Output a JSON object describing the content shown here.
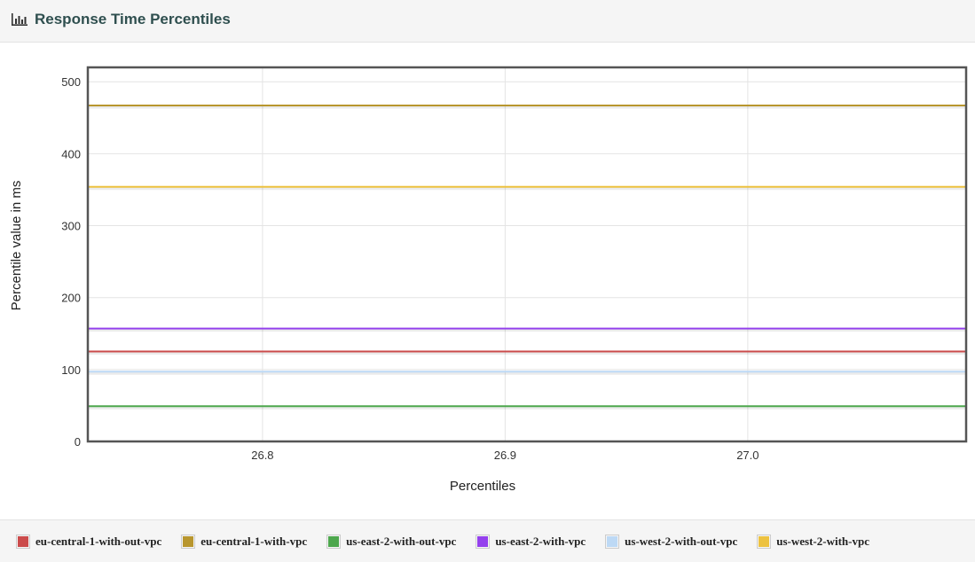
{
  "header": {
    "title": "Response Time Percentiles",
    "icon": "bar-chart-icon"
  },
  "chart_data": {
    "type": "line",
    "xlabel": "Percentiles",
    "ylabel": "Percentile value in ms",
    "xlim": [
      26.728,
      27.09
    ],
    "ylim": [
      0,
      520
    ],
    "xticks": [
      "26.8",
      "26.9",
      "27.0",
      "27.1",
      "27.2"
    ],
    "yticks": [
      "0",
      "100",
      "200",
      "300",
      "400",
      "500"
    ],
    "grid": true,
    "legend_position": "bottom",
    "series": [
      {
        "name": "eu-central-1-with-out-vpc",
        "color": "#cb4b4b",
        "x": [
          26.728,
          27.09
        ],
        "y": [
          125,
          125
        ]
      },
      {
        "name": "eu-central-1-with-vpc",
        "color": "#b8962e",
        "x": [
          26.728,
          27.09
        ],
        "y": [
          467,
          467
        ]
      },
      {
        "name": "us-east-2-with-out-vpc",
        "color": "#4da74d",
        "x": [
          26.728,
          27.09
        ],
        "y": [
          49,
          49
        ]
      },
      {
        "name": "us-east-2-with-vpc",
        "color": "#9440ed",
        "x": [
          26.728,
          27.09
        ],
        "y": [
          157,
          157
        ]
      },
      {
        "name": "us-west-2-with-out-vpc",
        "color": "#bdd9f5",
        "x": [
          26.728,
          27.09
        ],
        "y": [
          97,
          97
        ]
      },
      {
        "name": "us-west-2-with-vpc",
        "color": "#edc240",
        "x": [
          26.728,
          27.09
        ],
        "y": [
          354,
          354
        ]
      }
    ]
  }
}
